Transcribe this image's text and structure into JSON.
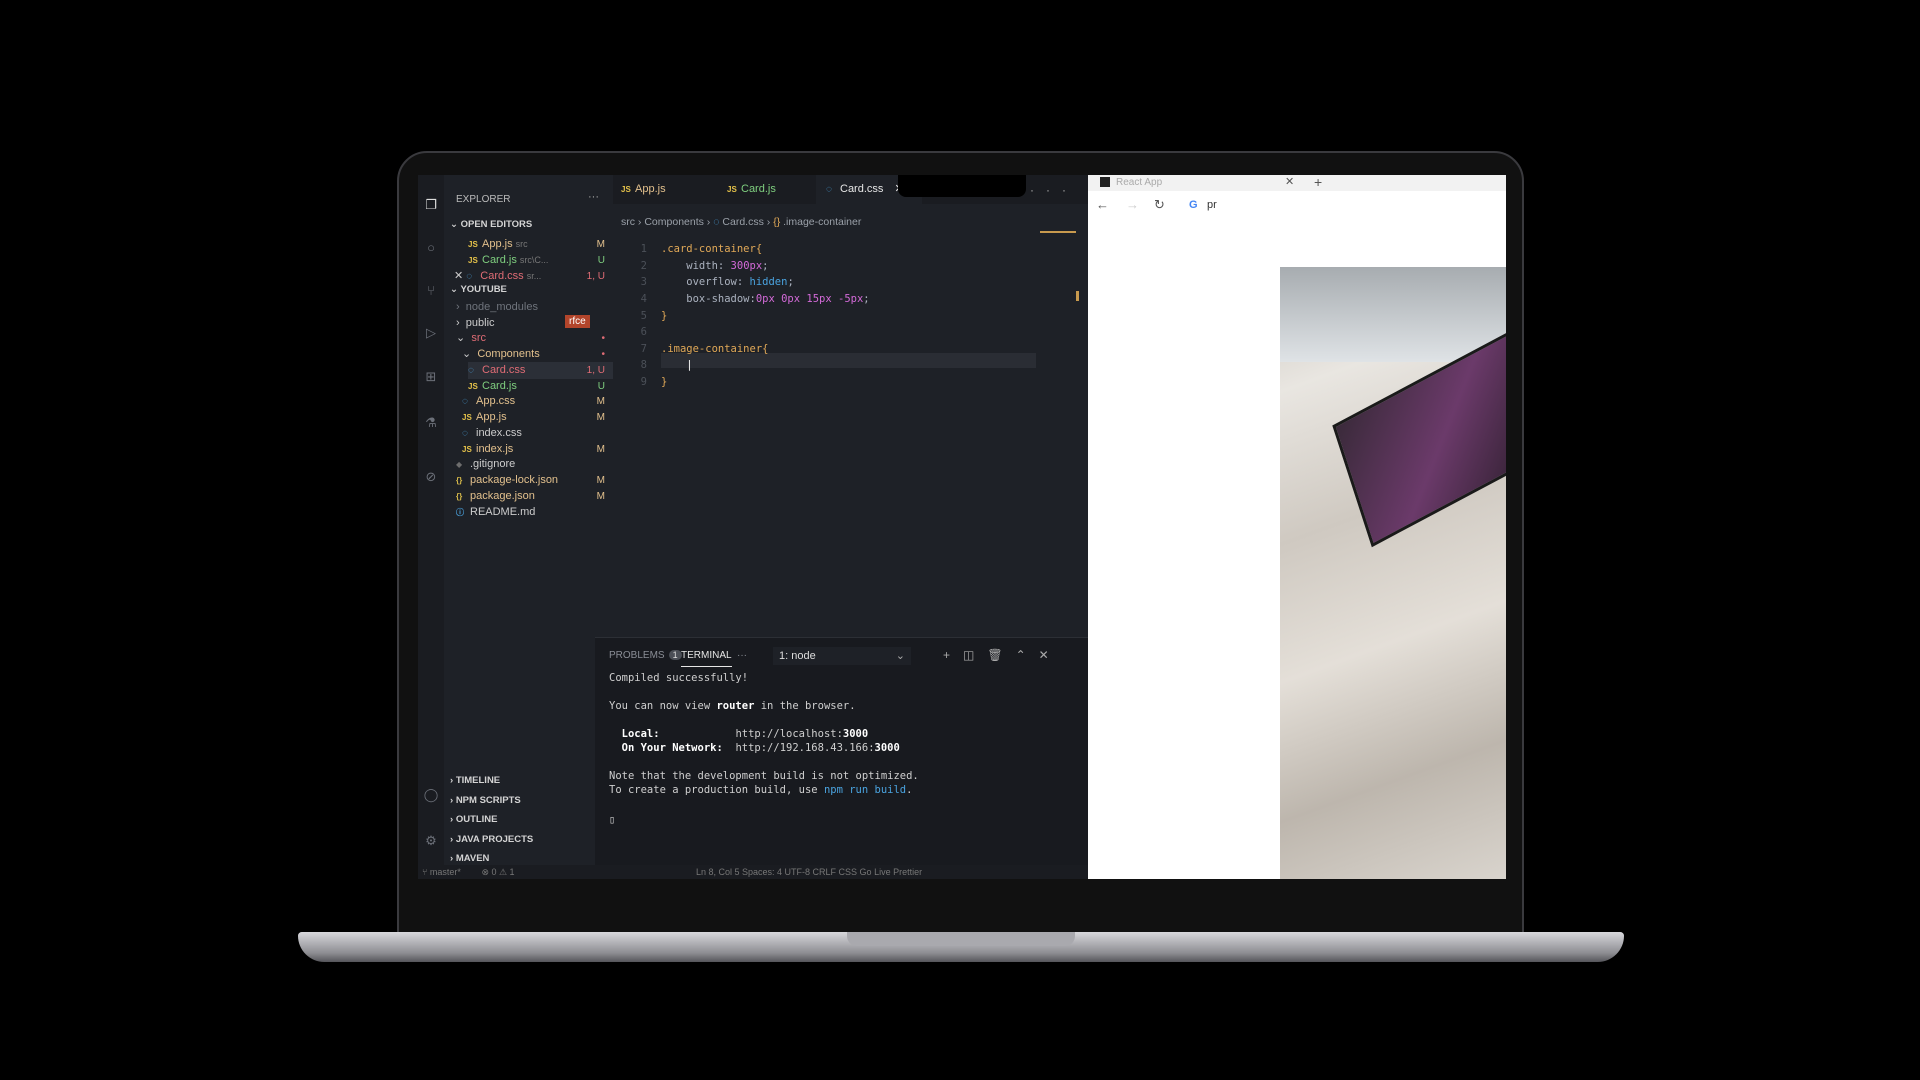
{
  "vscode": {
    "explorer_title": "EXPLORER",
    "open_editors_title": "OPEN EDITORS",
    "open_editors": [
      {
        "icon": "JS",
        "name": "App.js",
        "path": "src",
        "status": "M"
      },
      {
        "icon": "JS",
        "name": "Card.js",
        "path": "src\\C...",
        "status": "U"
      },
      {
        "icon": "CSS",
        "name": "Card.css",
        "path": "sr...",
        "status": "1, U"
      }
    ],
    "project_title": "YOUTUBE",
    "tree": {
      "node_modules": "node_modules",
      "rfce": "rfce",
      "public": "public",
      "src": "src",
      "components": "Components",
      "card_css": {
        "name": "Card.css",
        "status": "1, U"
      },
      "card_js": {
        "name": "Card.js",
        "status": "U"
      },
      "app_css": {
        "name": "App.css",
        "status": "M"
      },
      "app_js": {
        "name": "App.js",
        "status": "M"
      },
      "index_css": {
        "name": "index.css"
      },
      "index_js": {
        "name": "index.js",
        "status": "M"
      },
      "gitignore": {
        "name": ".gitignore"
      },
      "package_lock": {
        "name": "package-lock.json",
        "status": "M"
      },
      "package_json": {
        "name": "package.json",
        "status": "M"
      },
      "readme": {
        "name": "README.md"
      }
    },
    "bottom_sections": [
      "TIMELINE",
      "NPM SCRIPTS",
      "OUTLINE",
      "JAVA PROJECTS",
      "MAVEN"
    ],
    "tabs": [
      {
        "icon": "JS",
        "label": "App.js"
      },
      {
        "icon": "JS",
        "label": "Card.js"
      },
      {
        "icon": "CSS",
        "label": "Card.css"
      }
    ],
    "breadcrumb": [
      "src",
      "Components",
      "Card.css",
      ".image-container"
    ],
    "code_lines": [
      "1",
      "2",
      "3",
      "4",
      "5",
      "6",
      "7",
      "8",
      "9"
    ],
    "code": {
      "l1_sel": ".card-container{",
      "l2_prop": "    width: ",
      "l2_val": "300px",
      "l2_end": ";",
      "l3_prop": "    overflow: ",
      "l3_val": "hidden",
      "l3_end": ";",
      "l4_prop": "    box-shadow:",
      "l4_val": "0px 0px 15px -5px",
      "l4_end": ";",
      "l5": "}",
      "l7_sel": ".image-container{",
      "l9": "}"
    },
    "panel": {
      "problems_label": "PROBLEMS",
      "problems_count": "1",
      "terminal_label": "TERMINAL",
      "more": "···",
      "terminal_select": "1: node"
    },
    "terminal": {
      "line1": "Compiled successfully!",
      "line2_a": "You can now view ",
      "line2_b": "router",
      "line2_c": " in the browser.",
      "local_label": "  Local:            ",
      "local_url_a": "http://localhost:",
      "local_url_b": "3000",
      "network_label": "  On Your Network:  ",
      "network_url_a": "http://192.168.43.166:",
      "network_url_b": "3000",
      "note1": "Note that the development build is not optimized.",
      "note2_a": "To create a production build, use ",
      "note2_b": "npm run build",
      "note2_c": "."
    },
    "status_left": "master*",
    "status_problems": "⊗ 0 ⚠ 1",
    "status_right": "Ln 8, Col 5    Spaces: 4    UTF-8    CRLF    CSS    Go Live    Prettier"
  },
  "browser": {
    "tab_title": "React App",
    "address_text": "pr",
    "google_letter": "G"
  }
}
